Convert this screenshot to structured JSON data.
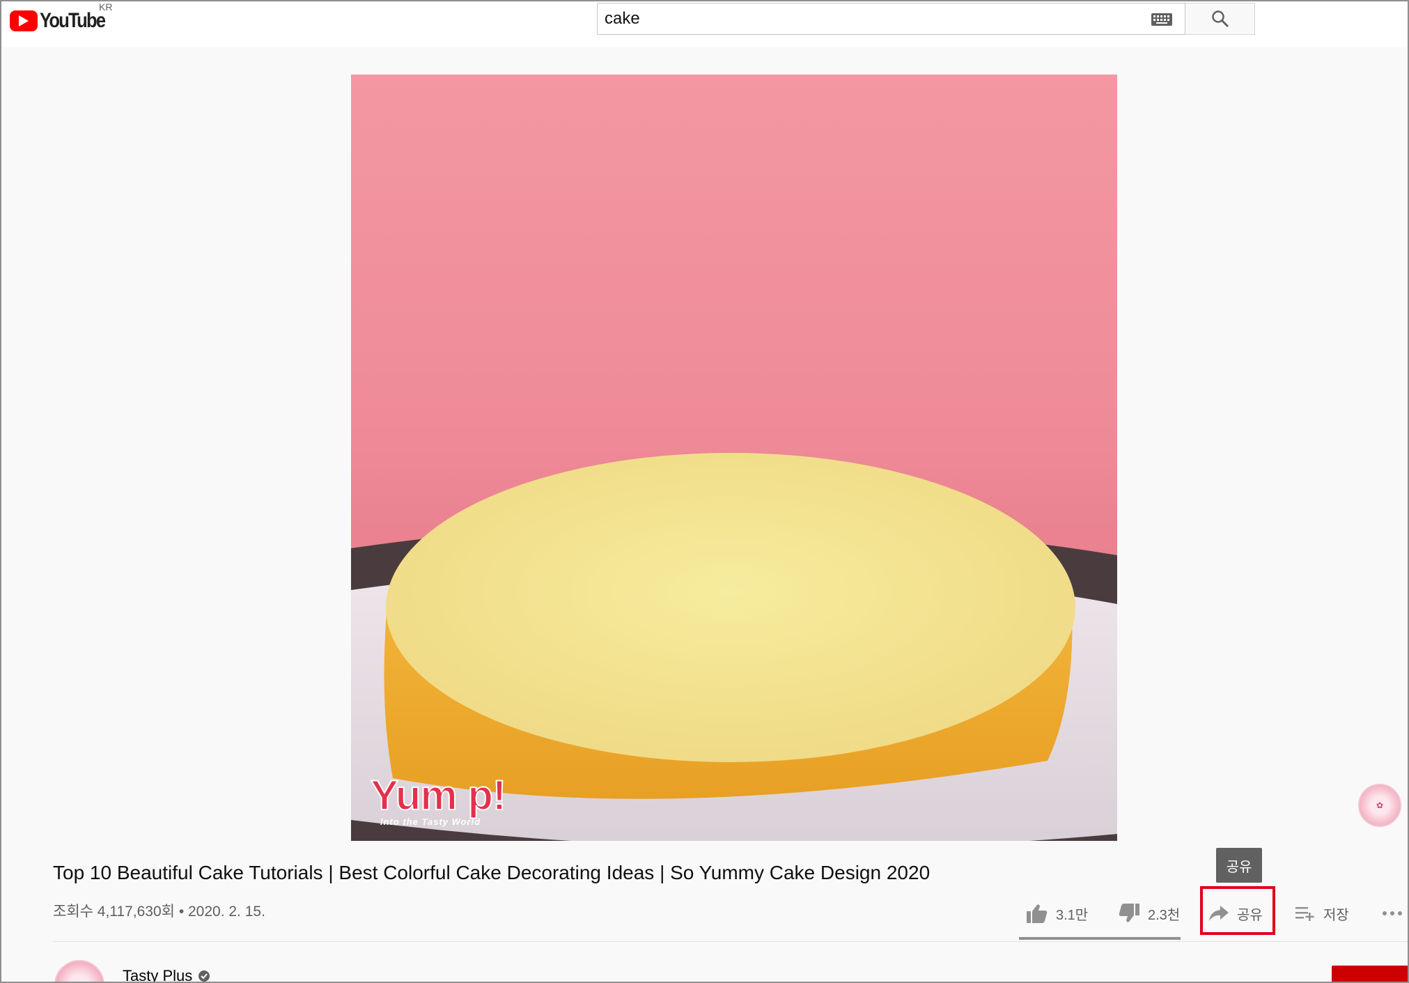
{
  "header": {
    "logo_text": "YouTube",
    "country_code": "KR",
    "search_value": "cake"
  },
  "video": {
    "watermark_brand": "Yum p!",
    "watermark_sub": "Into the Tasty World"
  },
  "tooltip": {
    "text": "공유"
  },
  "details": {
    "title": "Top 10 Beautiful Cake Tutorials | Best Colorful Cake Decorating Ideas | So Yummy Cake Design 2020",
    "views_date": "조회수 4,117,630회 • 2020. 2. 15."
  },
  "actions": {
    "likes": "3.1만",
    "dislikes": "2.3천",
    "share": "공유",
    "save": "저장",
    "more_icon": "more-horiz-icon"
  },
  "channel": {
    "name": "Tasty Plus",
    "verified": true
  },
  "colors": {
    "brand_red": "#ff0000",
    "highlight": "#e1001a",
    "video_bg": "#f08d9a"
  }
}
